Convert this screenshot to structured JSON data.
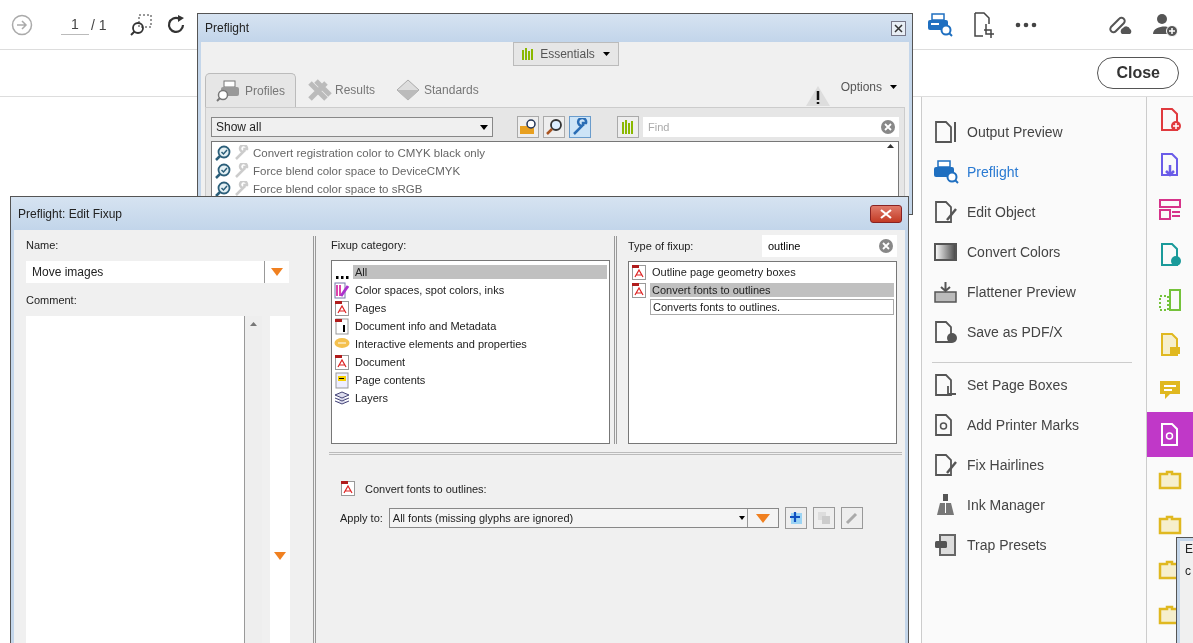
{
  "toolbar": {
    "page_number": "1",
    "page_total": "/ 1"
  },
  "close_button": "Close",
  "tool_groups": [
    [
      {
        "label": "Output Preview",
        "selected": false,
        "kind": "docslider"
      },
      {
        "label": "Preflight",
        "selected": true,
        "kind": "printer"
      },
      {
        "label": "Edit Object",
        "selected": false,
        "kind": "editobject"
      },
      {
        "label": "Convert Colors",
        "selected": false,
        "kind": "gradient"
      },
      {
        "label": "Flattener Preview",
        "selected": false,
        "kind": "flattener"
      },
      {
        "label": "Save as PDF/X",
        "selected": false,
        "kind": "savex"
      }
    ],
    [
      {
        "label": "Set Page Boxes",
        "selected": false,
        "kind": "crop"
      },
      {
        "label": "Add Printer Marks",
        "selected": false,
        "kind": "target"
      },
      {
        "label": "Fix Hairlines",
        "selected": false,
        "kind": "pencil"
      },
      {
        "label": "Ink Manager",
        "selected": false,
        "kind": "ink"
      },
      {
        "label": "Trap Presets",
        "selected": false,
        "kind": "trap"
      }
    ]
  ],
  "side_strip": [
    {
      "kind": "addpdf",
      "selected": false
    },
    {
      "kind": "exportpdf",
      "selected": false
    },
    {
      "kind": "form",
      "selected": false
    },
    {
      "kind": "sendpdf",
      "selected": false
    },
    {
      "kind": "compare",
      "selected": false
    },
    {
      "kind": "notedoc",
      "selected": false
    },
    {
      "kind": "comment",
      "selected": false
    },
    {
      "kind": "printprod",
      "selected": true
    },
    {
      "kind": "folder",
      "selected": false
    },
    {
      "kind": "folder",
      "selected": false
    },
    {
      "kind": "folder",
      "selected": false
    },
    {
      "kind": "folder",
      "selected": false
    }
  ],
  "preflight_window": {
    "title": "Preflight",
    "essentials": "Essentials",
    "tabs": [
      {
        "label": "Profiles",
        "selected": true,
        "kind": "profiles"
      },
      {
        "label": "Results",
        "selected": false,
        "kind": "results"
      },
      {
        "label": "Standards",
        "selected": false,
        "kind": "standards"
      }
    ],
    "options": "Options",
    "filter": "Show all",
    "find_placeholder": "Find",
    "rows": [
      "Convert registration color to CMYK black only",
      "Force blend color space to DeviceCMYK",
      "Force blend color space to sRGB"
    ]
  },
  "edit_fixup": {
    "title": "Preflight: Edit Fixup",
    "name_label": "Name:",
    "name_value": "Move images",
    "comment_label": "Comment:",
    "category_label": "Fixup category:",
    "categories": [
      {
        "label": "All",
        "selected": true,
        "kind": "all"
      },
      {
        "label": "Color spaces, spot colors, inks",
        "selected": false,
        "kind": "colors"
      },
      {
        "label": "Pages",
        "selected": false,
        "kind": "pdf"
      },
      {
        "label": "Document info and Metadata",
        "selected": false,
        "kind": "info"
      },
      {
        "label": "Interactive elements and properties",
        "selected": false,
        "kind": "bubble"
      },
      {
        "label": "Document",
        "selected": false,
        "kind": "pdf"
      },
      {
        "label": "Page contents",
        "selected": false,
        "kind": "content"
      },
      {
        "label": "Layers",
        "selected": false,
        "kind": "layers"
      }
    ],
    "type_label": "Type of fixup:",
    "type_search": "outline",
    "fixups": [
      {
        "label": "Outline page geometry boxes",
        "selected": false,
        "kind": "item"
      },
      {
        "label": "Convert fonts to outlines",
        "selected": true,
        "kind": "item"
      },
      {
        "label": "Converts fonts to outlines.",
        "kind": "description"
      }
    ],
    "detail_title": "Convert fonts to outlines:",
    "apply_label": "Apply to:",
    "apply_value": "All fonts (missing glyphs are ignored)"
  },
  "partial_window": {
    "title": "E",
    "text": "c"
  }
}
